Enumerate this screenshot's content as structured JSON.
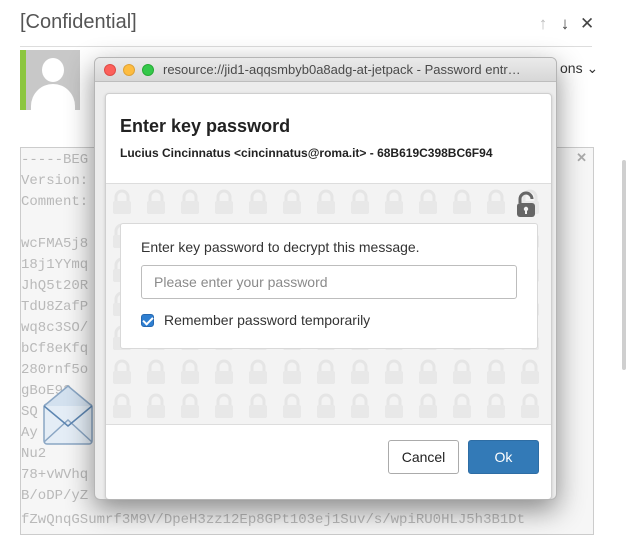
{
  "email": {
    "subject": "[Confidential]",
    "actions": {
      "up_glyph": "↑",
      "down_glyph": "↓",
      "close_glyph": "✕"
    },
    "options_label": "ons ⌄",
    "sender_color": "#8cc63f",
    "pgp_close_glyph": "✕",
    "pgp_lines": [
      "-----BEG",
      "Version:",
      "Comment:",
      "",
      "wcFMA5j8",
      "18j1YYmq",
      "JhQ5t20R",
      "TdU8ZafP",
      "wq8c3SO/",
      "bCf8eKfq",
      "280rnf5o",
      "gBoE92",
      "SQ",
      "Ay",
      "Nu2",
      "78+vWVhq",
      "B/oDP/yZ",
      "fZwQnqGSumrf3M9V/DpeH3zz12Ep8GPt103ej1Suv/s/wpiRU0HLJ5h3B1Dt"
    ]
  },
  "dialog": {
    "window_title": "resource://jid1-aqqsmbyb0a8adg-at-jetpack - Password entr…",
    "heading": "Enter key password",
    "user_info": "Lucius Cincinnatus <cincinnatus@roma.it> - 68B619C398BC6F94",
    "instruction": "Enter key password to decrypt this message.",
    "password": {
      "value": "",
      "placeholder": "Please enter your password"
    },
    "remember": {
      "label": "Remember password temporarily",
      "checked": true
    },
    "buttons": {
      "cancel": "Cancel",
      "ok": "Ok"
    },
    "accent_color": "#337ab7"
  }
}
